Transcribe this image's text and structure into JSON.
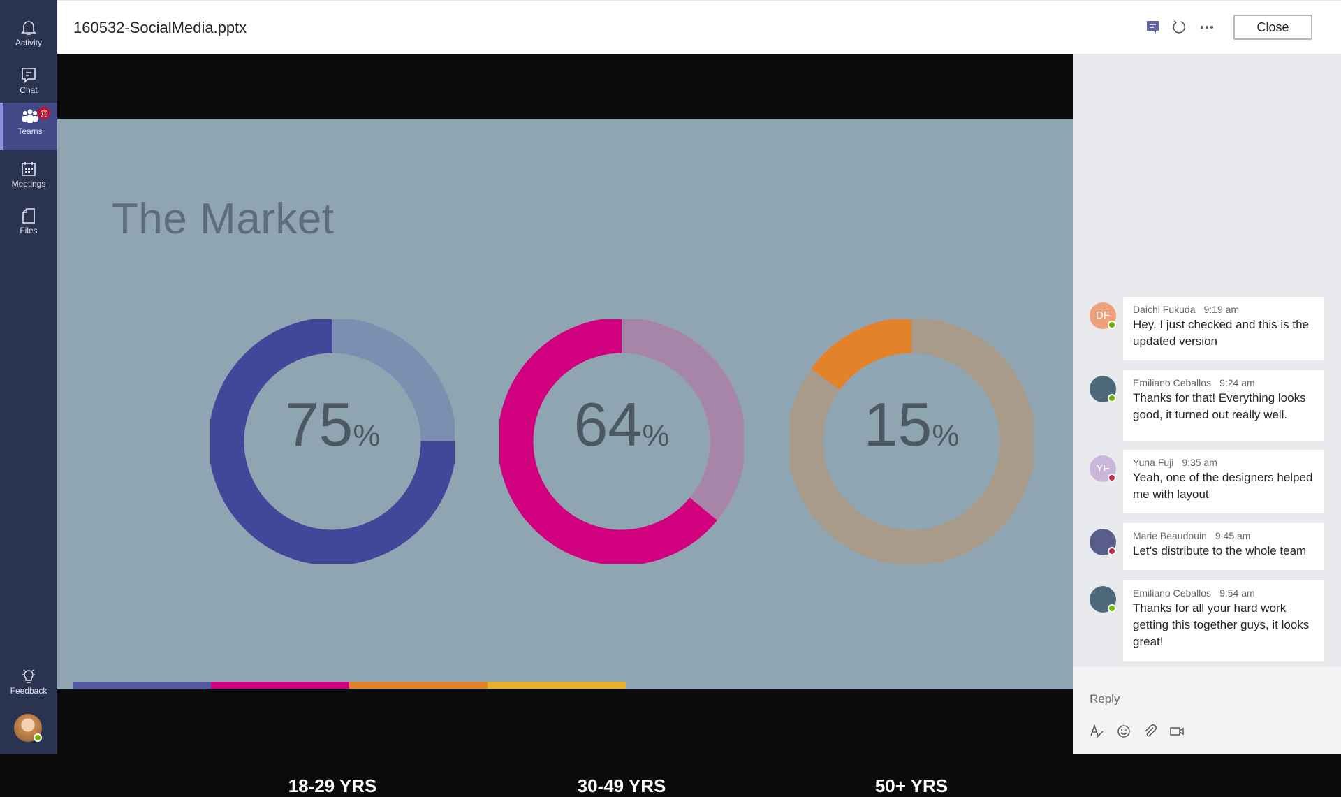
{
  "rail": {
    "items": [
      {
        "label": "Activity",
        "icon": "bell-icon"
      },
      {
        "label": "Chat",
        "icon": "chat-icon"
      },
      {
        "label": "Teams",
        "icon": "teams-icon",
        "badge": "@",
        "active": true
      },
      {
        "label": "Meetings",
        "icon": "calendar-icon"
      },
      {
        "label": "Files",
        "icon": "file-icon"
      }
    ],
    "feedback": "Feedback"
  },
  "header": {
    "title": "160532-SocialMedia.pptx",
    "close": "Close",
    "accent": "#6264a7"
  },
  "slide": {
    "title": "The Market",
    "background": "#8fa6b2",
    "bar_colors": [
      "#5558a0",
      "#d0007f",
      "#e4822a",
      "#e8b12b"
    ]
  },
  "chart_data": {
    "type": "pie",
    "variant": "donut",
    "series": [
      {
        "label": "18-29 YRS",
        "value": 75,
        "display": "75",
        "unit": "%",
        "color": "#414799",
        "rest_color": "#7d8fb0"
      },
      {
        "label": "30-49 YRS",
        "value": 64,
        "display": "64",
        "unit": "%",
        "color": "#d0007f",
        "rest_color": "#a785a8"
      },
      {
        "label": "50+ YRS",
        "value": 15,
        "display": "15",
        "unit": "%",
        "color": "#e4822a",
        "rest_color": "#a89b8a"
      }
    ]
  },
  "chat": {
    "messages": [
      {
        "author": "Daichi Fukuda",
        "initials": "DF",
        "time": "9:19 am",
        "text": "Hey, I just checked and this is the updated version",
        "status": "available",
        "avatar_color": "#eda07a"
      },
      {
        "author": "Emiliano Ceballos",
        "initials": "",
        "time": "9:24 am",
        "text": "Thanks for that! Everything looks good, it turned out really well.",
        "status": "available",
        "avatar_color": "#4e6a7a"
      },
      {
        "author": "Yuna Fuji",
        "initials": "YF",
        "time": "9:35 am",
        "text": "Yeah, one of the designers helped me with layout",
        "status": "busy",
        "avatar_color": "#c9b6d9"
      },
      {
        "author": "Marie Beaudouin",
        "initials": "",
        "time": "9:45 am",
        "text": "Let’s distribute to the whole team",
        "status": "busy",
        "avatar_color": "#5a5e8a"
      },
      {
        "author": "Emiliano Ceballos",
        "initials": "",
        "time": "9:54 am",
        "text": "Thanks for all your hard work getting this together guys, it looks great!",
        "status": "available",
        "avatar_color": "#4e6a7a"
      }
    ],
    "reply_placeholder": "Reply"
  }
}
